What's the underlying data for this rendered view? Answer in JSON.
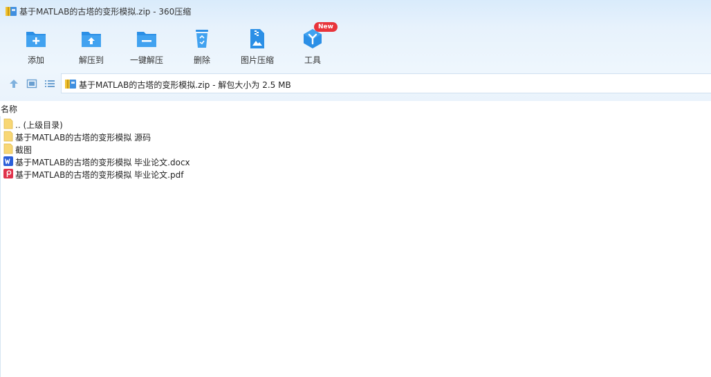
{
  "window": {
    "title": "基于MATLAB的古塔的变形模拟.zip - 360压缩"
  },
  "toolbar": {
    "items": [
      {
        "label": "添加"
      },
      {
        "label": "解压到"
      },
      {
        "label": "一键解压"
      },
      {
        "label": "删除"
      },
      {
        "label": "图片压缩"
      },
      {
        "label": "工具"
      }
    ],
    "badge": "New"
  },
  "pathbar": {
    "text": "基于MATLAB的古塔的变形模拟.zip - 解包大小为 2.5 MB"
  },
  "columns": {
    "name": "名称"
  },
  "files": [
    {
      "name": ".. (上级目录)",
      "type": "folder"
    },
    {
      "name": "基于MATLAB的古塔的变形模拟 源码",
      "type": "folder"
    },
    {
      "name": "截图",
      "type": "folder"
    },
    {
      "name": "基于MATLAB的古塔的变形模拟 毕业论文.docx",
      "type": "word"
    },
    {
      "name": "基于MATLAB的古塔的变形模拟 毕业论文.pdf",
      "type": "pdf"
    }
  ],
  "colors": {
    "accent": "#2b8fe6",
    "badge": "#e8343b",
    "folder": "#f8d775",
    "word": "#2b5fd9",
    "pdf": "#e0334b"
  }
}
